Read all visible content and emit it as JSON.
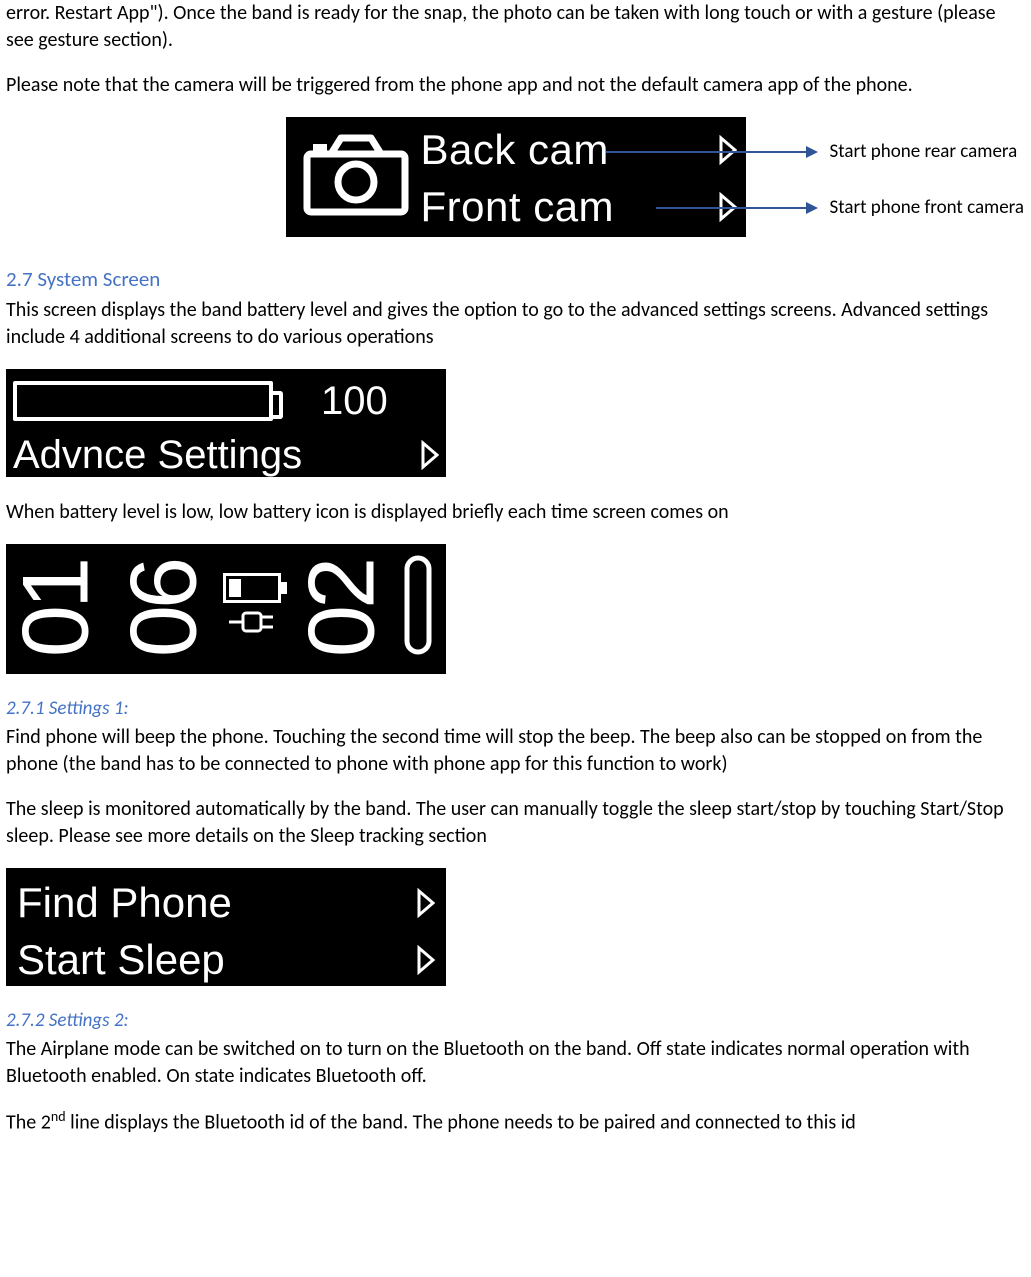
{
  "intro_para_1": "error. Restart App\"). Once the band is ready for the snap, the photo can be taken with long touch or with a gesture (please see gesture section).",
  "intro_para_2": "Please note that the camera will be triggered from the phone app  and not the default camera app of the phone.",
  "cam": {
    "back_label": "Back cam",
    "front_label": "Front cam",
    "callout_rear": "Start phone rear camera",
    "callout_front": "Start phone front camera"
  },
  "sec27": {
    "heading": "2.7 System Screen",
    "para": "This screen displays the band battery level and gives the option to go to the advanced settings screens. Advanced settings include 4 additional screens to do various operations",
    "battery_value": "100",
    "adv_label": "Advnce Settings",
    "low_batt_para": "When battery level is low, low battery icon is displayed briefly each time screen comes on",
    "clock_d1": "01",
    "clock_d2": "06",
    "clock_d3": "02"
  },
  "sec271": {
    "heading": "2.7.1 Settings 1:",
    "para1": "Find phone will beep the phone. Touching the second time will stop the beep. The beep also can be stopped on from the phone (the band has to be connected to phone with phone app for this function to work)",
    "para2": "The sleep is monitored automatically by the band. The user can manually toggle the sleep start/stop by touching Start/Stop sleep. Please see more details on the Sleep tracking section",
    "find_label": "Find Phone",
    "sleep_label": "Start Sleep"
  },
  "sec272": {
    "heading": "2.7.2 Settings 2:",
    "para1": "The Airplane mode can be switched on to turn on the Bluetooth on the band. Off state indicates normal operation with Bluetooth enabled. On state indicates Bluetooth off.",
    "para2_pre": "The 2",
    "para2_sup": "nd",
    "para2_post": " line displays the Bluetooth id of the band. The phone needs to be paired and connected to this id"
  }
}
